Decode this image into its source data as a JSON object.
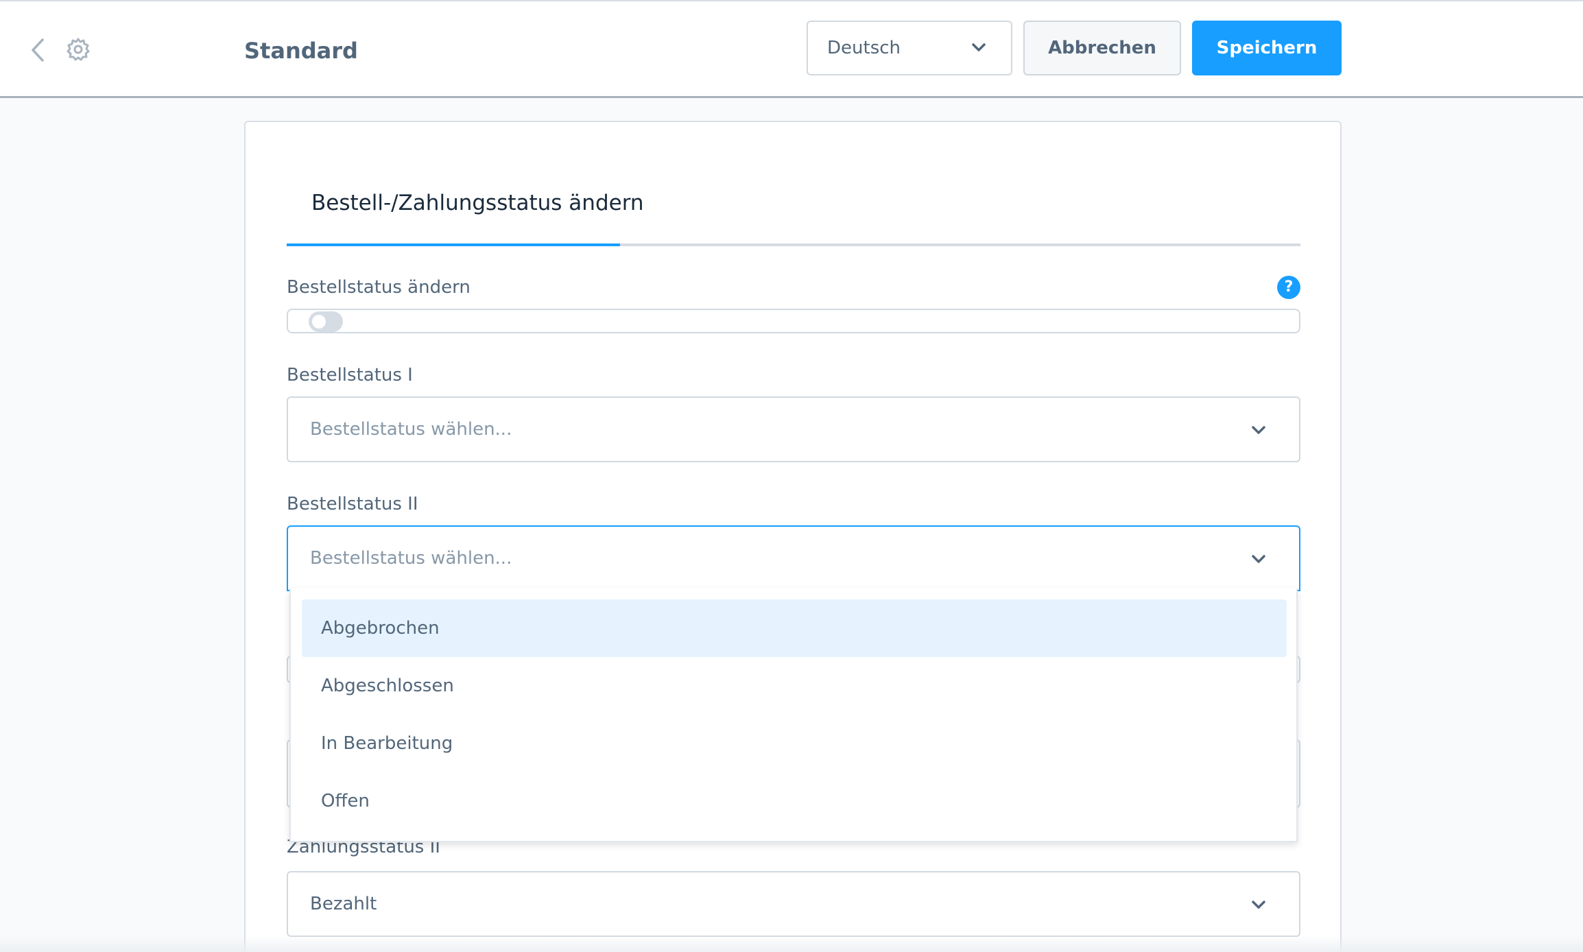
{
  "header": {
    "title": "Standard",
    "language": {
      "selected": "Deutsch"
    },
    "cancel_label": "Abbrechen",
    "save_label": "Speichern"
  },
  "tab": {
    "label": "Bestell-/Zahlungsstatus ändern"
  },
  "fields": {
    "change_order_status": {
      "label": "Bestellstatus ändern",
      "enabled": false,
      "help_icon": "question-icon",
      "help_glyph": "?"
    },
    "order_status_1": {
      "label": "Bestellstatus I",
      "placeholder": "Bestellstatus wählen..."
    },
    "order_status_2": {
      "label": "Bestellstatus II",
      "placeholder": "Bestellstatus wählen..."
    },
    "payment_status_2": {
      "label": "Zahlungsstatus II",
      "value": "Bezahlt"
    }
  },
  "dropdown": {
    "options": [
      "Abgebrochen",
      "Abgeschlossen",
      "In Bearbeitung",
      "Offen"
    ],
    "highlighted_index": 0
  },
  "colors": {
    "accent": "#189eff",
    "text": "#52667a",
    "border": "#d1d9e0",
    "highlight": "#e6f3fe"
  }
}
